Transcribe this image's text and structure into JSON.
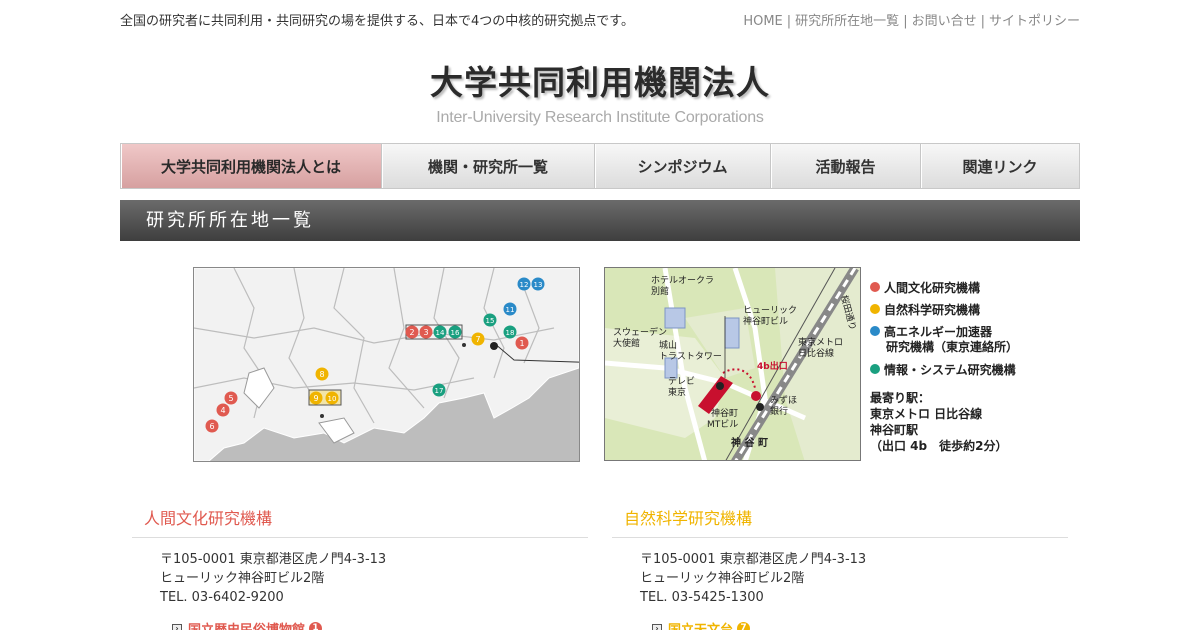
{
  "header": {
    "tagline": "全国の研究者に共同利用・共同研究の場を提供する、日本で4つの中核的研究拠点です。",
    "util_links": [
      "HOME",
      "研究所所在地一覧",
      "お問い合せ",
      "サイトポリシー"
    ]
  },
  "logo": {
    "jp": "大学共同利用機関法人",
    "en": "Inter-University Research Institute Corporations"
  },
  "nav": [
    {
      "label": "大学共同利用機関法人とは",
      "active": true
    },
    {
      "label": "機関・研究所一覧",
      "active": false
    },
    {
      "label": "シンポジウム",
      "active": false
    },
    {
      "label": "活動報告",
      "active": false
    },
    {
      "label": "関連リンク",
      "active": false
    }
  ],
  "section_title": "研究所所在地一覧",
  "map": {
    "markers": [
      {
        "n": "1",
        "color": "#e05a50"
      },
      {
        "n": "2",
        "color": "#e05a50"
      },
      {
        "n": "3",
        "color": "#e05a50"
      },
      {
        "n": "4",
        "color": "#e05a50"
      },
      {
        "n": "5",
        "color": "#e05a50"
      },
      {
        "n": "6",
        "color": "#e05a50"
      },
      {
        "n": "7",
        "color": "#f0b400"
      },
      {
        "n": "8",
        "color": "#f0b400"
      },
      {
        "n": "9",
        "color": "#f0b400"
      },
      {
        "n": "10",
        "color": "#f0b400"
      },
      {
        "n": "11",
        "color": "#2a8ac8"
      },
      {
        "n": "12",
        "color": "#2a8ac8"
      },
      {
        "n": "13",
        "color": "#2a8ac8"
      },
      {
        "n": "14",
        "color": "#1aa080"
      },
      {
        "n": "15",
        "color": "#1aa080"
      },
      {
        "n": "16",
        "color": "#1aa080"
      },
      {
        "n": "17",
        "color": "#1aa080"
      },
      {
        "n": "18",
        "color": "#1aa080"
      }
    ],
    "detail_labels": {
      "hotel": "ホテルオークラ",
      "hotel2": "別館",
      "sweden": "スウェーデン",
      "sweden2": "大使館",
      "shiroyama": "城山",
      "shiroyama2": "トラストタワー",
      "tv": "テレビ",
      "tv2": "東京",
      "hulic": "ヒューリック",
      "hulic2": "神谷町ビル",
      "exit": "4b出口",
      "metro": "東京メトロ",
      "metro2": "日比谷線",
      "mizuho": "みずほ",
      "mizuho2": "銀行",
      "mt": "神谷町",
      "mt2": "MTビル",
      "kamiyacho": "神 谷 町",
      "sakurada": "桜田通り"
    }
  },
  "legend": [
    {
      "label": "人間文化研究機構",
      "color": "#e05a50"
    },
    {
      "label": "自然科学研究機構",
      "color": "#f0b400"
    },
    {
      "label": "高エネルギー加速器",
      "color": "#2a8ac8",
      "label2": "研究機構（東京連絡所）"
    },
    {
      "label": "情報・システム研究機構",
      "color": "#1aa080"
    }
  ],
  "station": {
    "l1": "最寄り駅：",
    "l2": "東京メトロ 日比谷線",
    "l3": "神谷町駅",
    "l4": "（出口 4b　徒歩約2分）"
  },
  "columns": [
    {
      "title": "人間文化研究機構",
      "color": "#e05a50",
      "addr1": "〒105-0001 東京都港区虎ノ門4-3-13",
      "addr2": "ヒューリック神谷町ビル2階",
      "tel": "TEL. 03-6402-9200",
      "link": "国立歴史民俗博物館",
      "num": "1"
    },
    {
      "title": "自然科学研究機構",
      "color": "#f0b400",
      "addr1": "〒105-0001 東京都港区虎ノ門4-3-13",
      "addr2": "ヒューリック神谷町ビル2階",
      "tel": "TEL. 03-5425-1300",
      "link": "国立天文台",
      "num": "7"
    }
  ]
}
